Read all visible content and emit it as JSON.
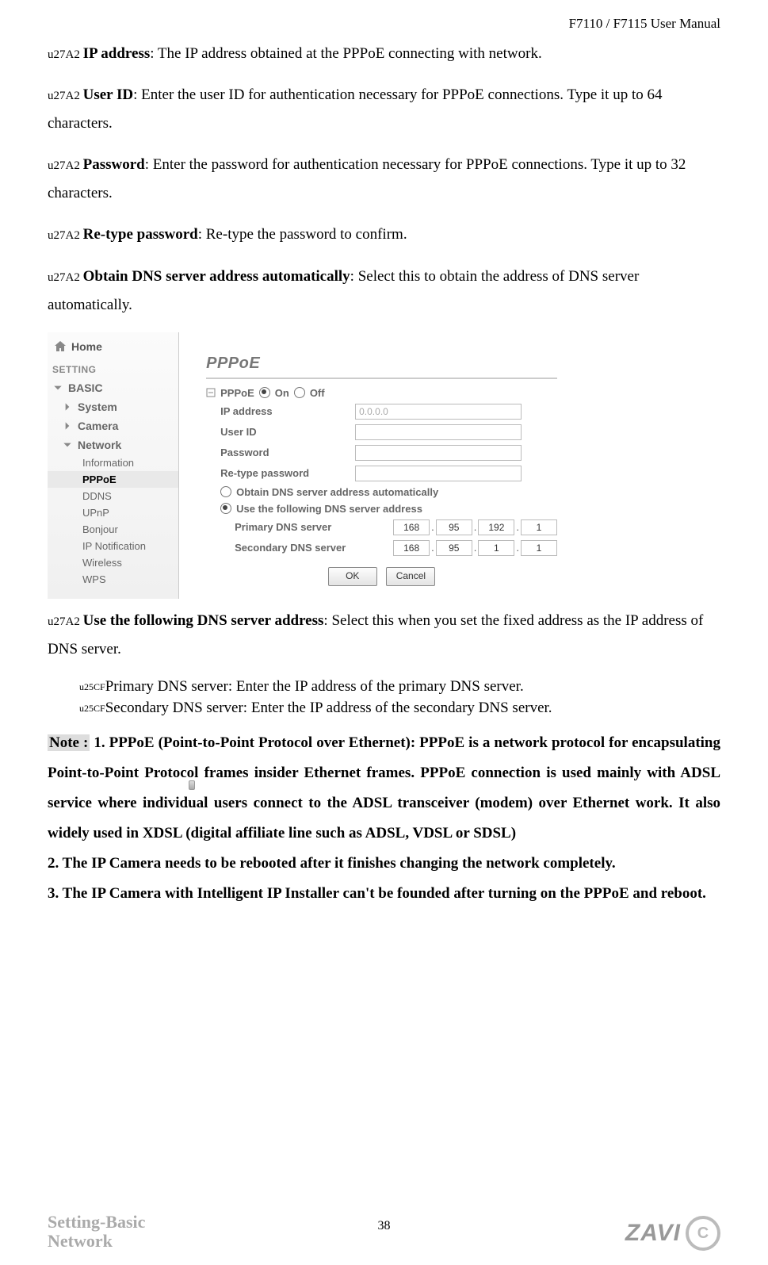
{
  "header": {
    "title": "F7110 / F7115 User Manual"
  },
  "prose": {
    "p1_label": "IP address",
    "p1_text": ": The IP address obtained at the PPPoE connecting with network.",
    "p2_label": "User ID",
    "p2_text": ": Enter the user ID for authentication necessary for PPPoE connections. Type it up to 64 characters.",
    "p3_label": "Password",
    "p3_text": ": Enter the password for authentication necessary for PPPoE connections. Type it up to 32 characters.",
    "p4_label": "Re-type password",
    "p4_text": ": Re-type the password to confirm.",
    "p5_label": "Obtain DNS server address automatically",
    "p5_text": ": Select this to obtain the address of DNS server automatically.",
    "p6_label": "Use the following DNS server address",
    "p6_text": ": Select this when you set the fixed address as the IP address of DNS server.",
    "sub1": "Primary DNS server: Enter the IP address of the primary DNS server.",
    "sub2": "Secondary DNS server: Enter the IP address of the secondary DNS server.",
    "note_label": "Note :",
    "note1": " 1. PPPoE (Point-to-Point Protocol over Ethernet): PPPoE is a network protocol for encapsulating Point-to-Point Protocol frames insider Ethernet frames. PPPoE connection is used mainly with ADSL service where individual users connect to the ADSL transceiver (modem) over Ethernet work. It also widely used in XDSL (digital affiliate line such as ADSL, VDSL or SDSL)",
    "note2": "2. The IP Camera needs to be rebooted after it finishes changing the network completely.",
    "note3": "3. The IP Camera with Intelligent IP Installer can't be founded after turning on the PPPoE and reboot."
  },
  "ui": {
    "nav": {
      "home": "Home",
      "setting": "SETTING",
      "basic": "BASIC",
      "system": "System",
      "camera": "Camera",
      "network": "Network",
      "subs": [
        "Information",
        "PPPoE",
        "DDNS",
        "UPnP",
        "Bonjour",
        "IP Notification",
        "Wireless",
        "WPS"
      ],
      "selected_index": 1
    },
    "panel_title": "PPPoE",
    "toggle_label": "PPPoE",
    "on": "On",
    "off": "Off",
    "rows": {
      "ip_label": "IP address",
      "ip_value": "0.0.0.0",
      "user_label": "User ID",
      "user_value": "",
      "pw_label": "Password",
      "pw_value": "",
      "rpw_label": "Re-type password",
      "rpw_value": ""
    },
    "dns": {
      "auto_label": "Obtain DNS server address automatically",
      "manual_label": "Use the following DNS server address",
      "primary_label": "Primary DNS server",
      "secondary_label": "Secondary DNS server",
      "primary": [
        "168",
        "95",
        "192",
        "1"
      ],
      "secondary": [
        "168",
        "95",
        "1",
        "1"
      ]
    },
    "buttons": {
      "ok": "OK",
      "cancel": "Cancel"
    }
  },
  "footer": {
    "left_line1": "Setting-Basic",
    "left_line2": "Network",
    "page": "38",
    "logo_text": "ZAVI"
  }
}
